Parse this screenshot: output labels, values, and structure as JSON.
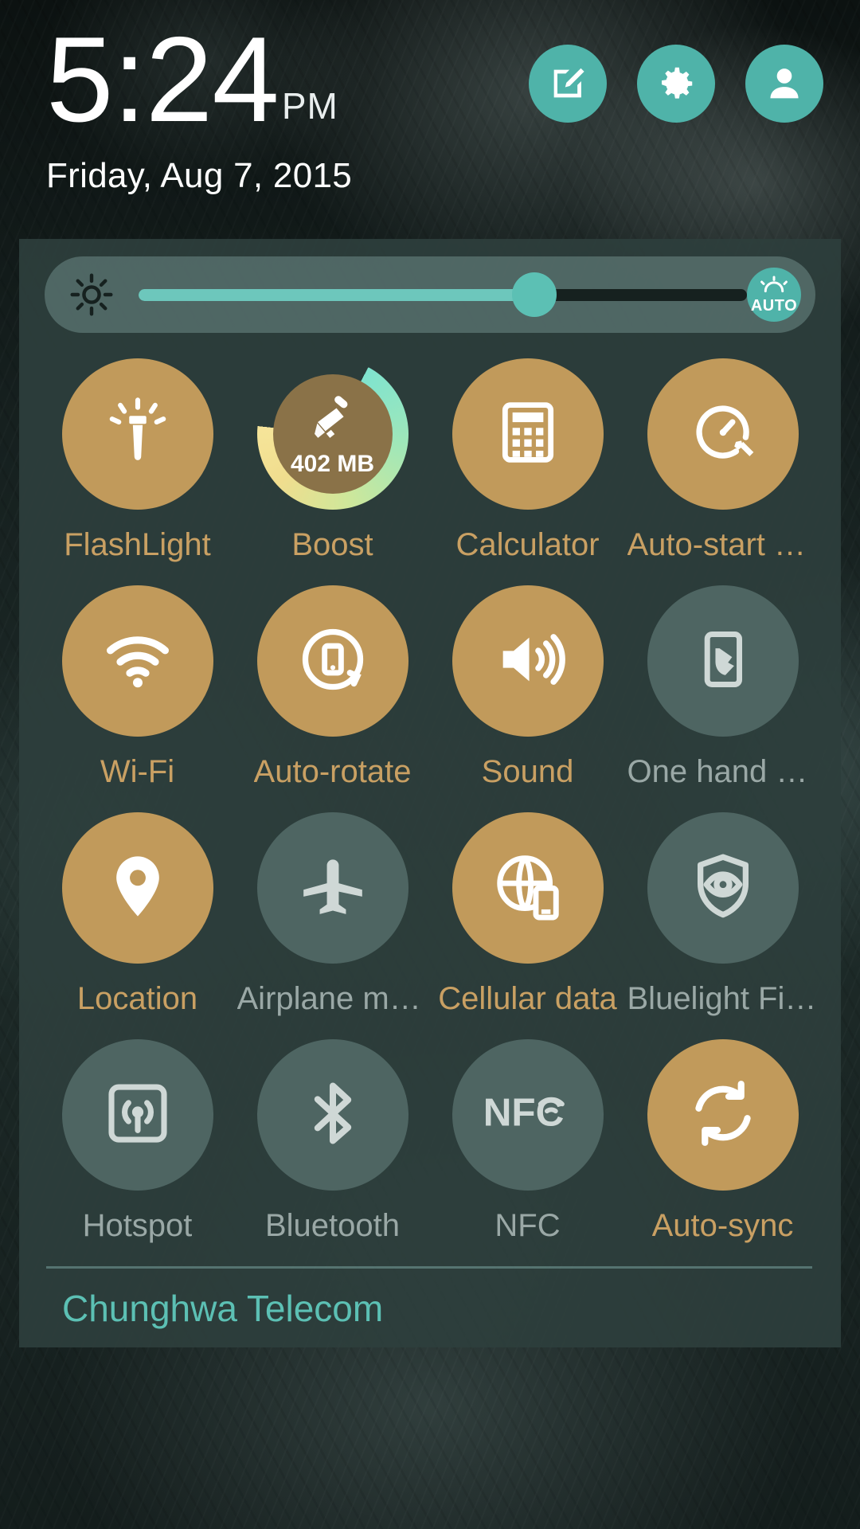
{
  "status": {
    "time": "5:24",
    "meridiem": "PM",
    "date": "Friday, Aug 7, 2015"
  },
  "header_actions": [
    {
      "name": "edit-button",
      "icon": "edit-icon"
    },
    {
      "name": "settings-button",
      "icon": "gear-icon"
    },
    {
      "name": "profile-button",
      "icon": "user-icon"
    }
  ],
  "brightness": {
    "icon": "brightness-sun-icon",
    "level_percent": 65,
    "auto_label": "AUTO",
    "auto_icon": "auto-brightness-icon",
    "auto_enabled": true
  },
  "tiles": [
    {
      "label": "FlashLight",
      "icon": "flashlight-icon",
      "state": "on"
    },
    {
      "label": "Boost",
      "icon": "broom-icon",
      "state": "on",
      "badge": "402 MB",
      "ring_percent": 69
    },
    {
      "label": "Calculator",
      "icon": "calculator-icon",
      "state": "on"
    },
    {
      "label": "Auto-start M…",
      "icon": "auto-start-icon",
      "state": "on"
    },
    {
      "label": "Wi-Fi",
      "icon": "wifi-icon",
      "state": "on"
    },
    {
      "label": "Auto-rotate",
      "icon": "auto-rotate-icon",
      "state": "on"
    },
    {
      "label": "Sound",
      "icon": "sound-icon",
      "state": "on"
    },
    {
      "label": "One hand op…",
      "icon": "one-hand-icon",
      "state": "off"
    },
    {
      "label": "Location",
      "icon": "location-pin-icon",
      "state": "on"
    },
    {
      "label": "Airplane mo…",
      "icon": "airplane-icon",
      "state": "off"
    },
    {
      "label": "Cellular data",
      "icon": "cellular-data-icon",
      "state": "on"
    },
    {
      "label": "Bluelight Filter",
      "icon": "shield-eye-icon",
      "state": "off"
    },
    {
      "label": "Hotspot",
      "icon": "hotspot-icon",
      "state": "off"
    },
    {
      "label": "Bluetooth",
      "icon": "bluetooth-icon",
      "state": "off"
    },
    {
      "label": "NFC",
      "icon": "nfc-icon",
      "state": "off"
    },
    {
      "label": "Auto-sync",
      "icon": "sync-icon",
      "state": "on"
    }
  ],
  "footer": {
    "carrier": "Chunghwa Telecom"
  },
  "colors": {
    "accent_teal": "#4fb3a9",
    "slider_teal": "#5cc0b4",
    "tile_on": "#c19a5b",
    "tile_off": "#4e6562",
    "label_on": "#c9a063",
    "label_off": "#9aa8a6",
    "panel_bg": "#2d3e3c"
  }
}
